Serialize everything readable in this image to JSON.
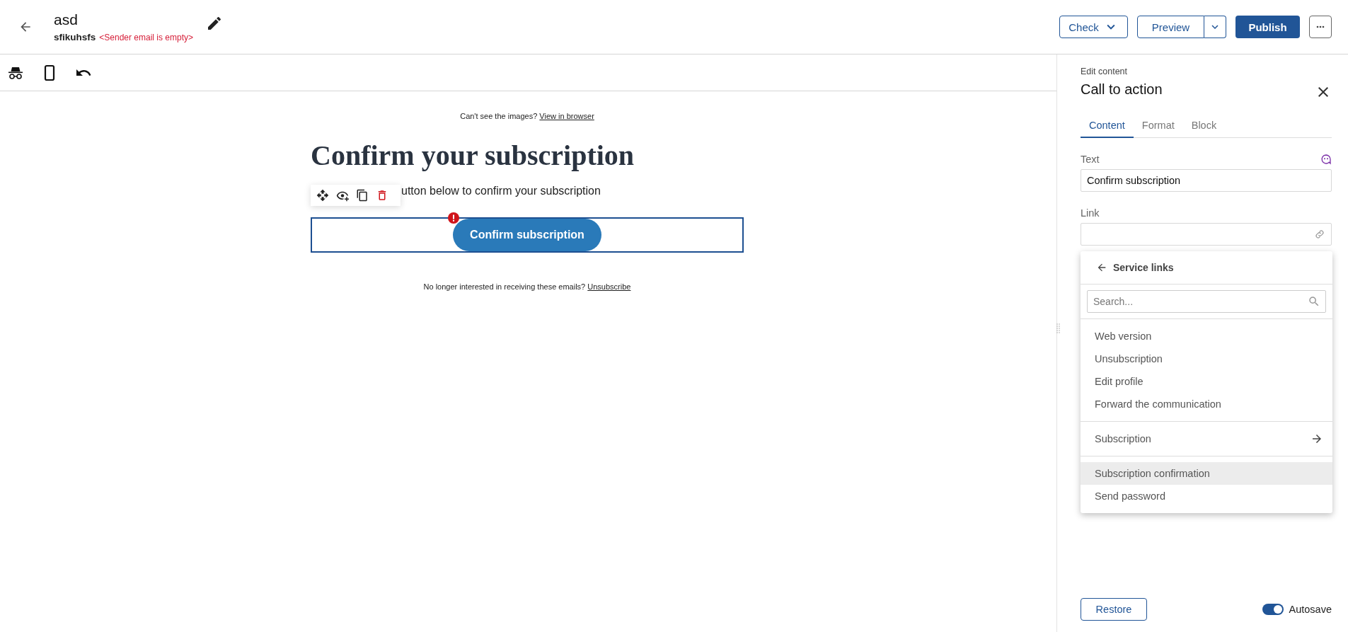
{
  "header": {
    "title": "asd",
    "sender": "sfikuhsfs",
    "warning": "<Sender email is empty>"
  },
  "actions": [
    {
      "kind": "dropdown",
      "label": "Check"
    },
    {
      "kind": "split",
      "label": "Preview"
    },
    {
      "kind": "primary",
      "label": "Publish"
    },
    {
      "kind": "more"
    }
  ],
  "canvas": {
    "preheader": {
      "text": "Can't see the images?",
      "link": "View in browser"
    },
    "heading": "Confirm your subscription",
    "paragraph": "utton below to confirm your subscription",
    "cta": {
      "label": "Confirm subscription",
      "error": true
    },
    "footer": {
      "text": "No longer interested in receiving these emails?",
      "link": "Unsubscribe"
    }
  },
  "panel": {
    "caption": "Edit content",
    "title": "Call to action",
    "tabs": [
      {
        "label": "Content",
        "selected": true
      },
      {
        "label": "Format",
        "selected": false
      },
      {
        "label": "Block",
        "selected": false
      }
    ],
    "fields": [
      {
        "kind": "text",
        "label": "Text",
        "value": "Confirm subscription"
      },
      {
        "kind": "link",
        "label": "Link"
      }
    ],
    "menu": {
      "title": "Service links",
      "search": {
        "placeholder": "Search..."
      },
      "groups": [
        {
          "items": [
            {
              "kind": "link",
              "label": "Web version",
              "highlighted": false
            },
            {
              "kind": "link",
              "label": "Unsubscription",
              "highlighted": false
            },
            {
              "kind": "link",
              "label": "Edit profile",
              "highlighted": false
            },
            {
              "kind": "link",
              "label": "Forward the communication",
              "highlighted": false
            }
          ]
        },
        {
          "items": [
            {
              "kind": "submenu",
              "label": "Subscription",
              "highlighted": false
            }
          ]
        },
        {
          "items": [
            {
              "kind": "link",
              "label": "Subscription confirmation",
              "highlighted": true
            },
            {
              "kind": "link",
              "label": "Send password",
              "highlighted": false
            }
          ]
        }
      ]
    },
    "restore": "Restore",
    "autosave": {
      "label": "Autosave",
      "on": true
    }
  }
}
